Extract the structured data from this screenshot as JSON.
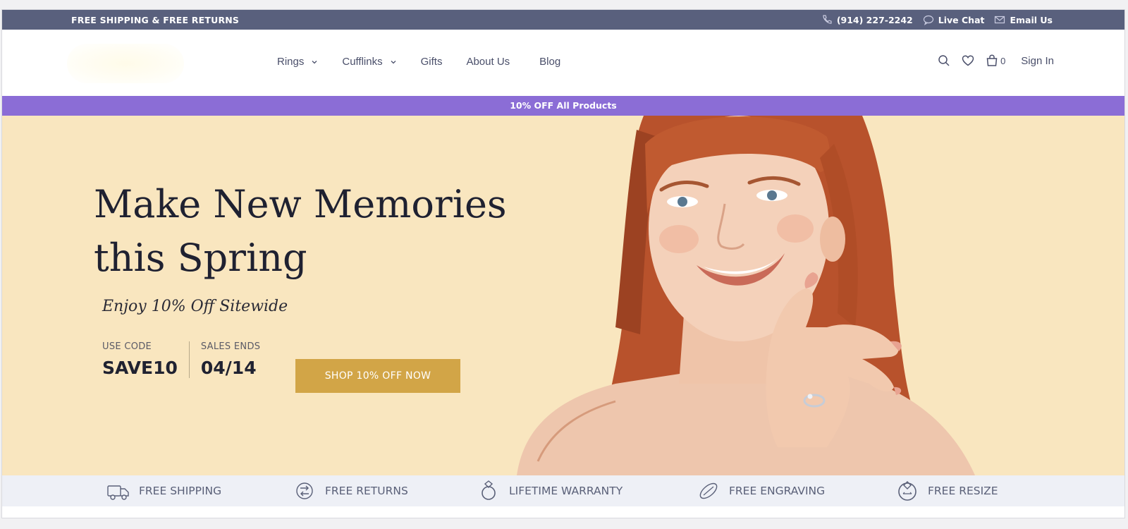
{
  "topbar": {
    "shipping": "FREE SHIPPING & FREE RETURNS",
    "phone": "(914) 227-2242",
    "chat": "Live Chat",
    "email": "Email Us",
    "icons": [
      "phone-icon",
      "chat-icon",
      "mail-icon"
    ]
  },
  "nav": {
    "items": [
      {
        "label": "Rings",
        "has_dropdown": true
      },
      {
        "label": "Cufflinks",
        "has_dropdown": true
      },
      {
        "label": "Gifts",
        "has_dropdown": false
      },
      {
        "label": "About Us",
        "has_dropdown": false
      },
      {
        "label": "Blog",
        "has_dropdown": false
      }
    ],
    "cart_count": "0",
    "sign_in": "Sign In",
    "icons": [
      "search-icon",
      "heart-icon",
      "bag-icon"
    ]
  },
  "promo": {
    "text": "10% OFF All Products"
  },
  "hero": {
    "headline": "Make New Memories this Spring",
    "subhead": "Enjoy 10% Off Sitewide",
    "code_label": "USE CODE",
    "code_value": "SAVE10",
    "ends_label": "SALES ENDS",
    "ends_value": "04/14",
    "cta": "SHOP 10% OFF NOW"
  },
  "features": [
    {
      "label": "FREE SHIPPING",
      "icon": "truck-icon"
    },
    {
      "label": "FREE RETURNS",
      "icon": "return-icon"
    },
    {
      "label": "LIFETIME WARRANTY",
      "icon": "ring-icon"
    },
    {
      "label": "FREE ENGRAVING",
      "icon": "engrave-icon"
    },
    {
      "label": "FREE RESIZE",
      "icon": "resize-icon"
    }
  ],
  "colors": {
    "topbar": "#59607d",
    "promo": "#8b6dd6",
    "hero_bg": "#f9e6bf",
    "cta": "#d2a547",
    "features_bg": "#eef0f6"
  }
}
